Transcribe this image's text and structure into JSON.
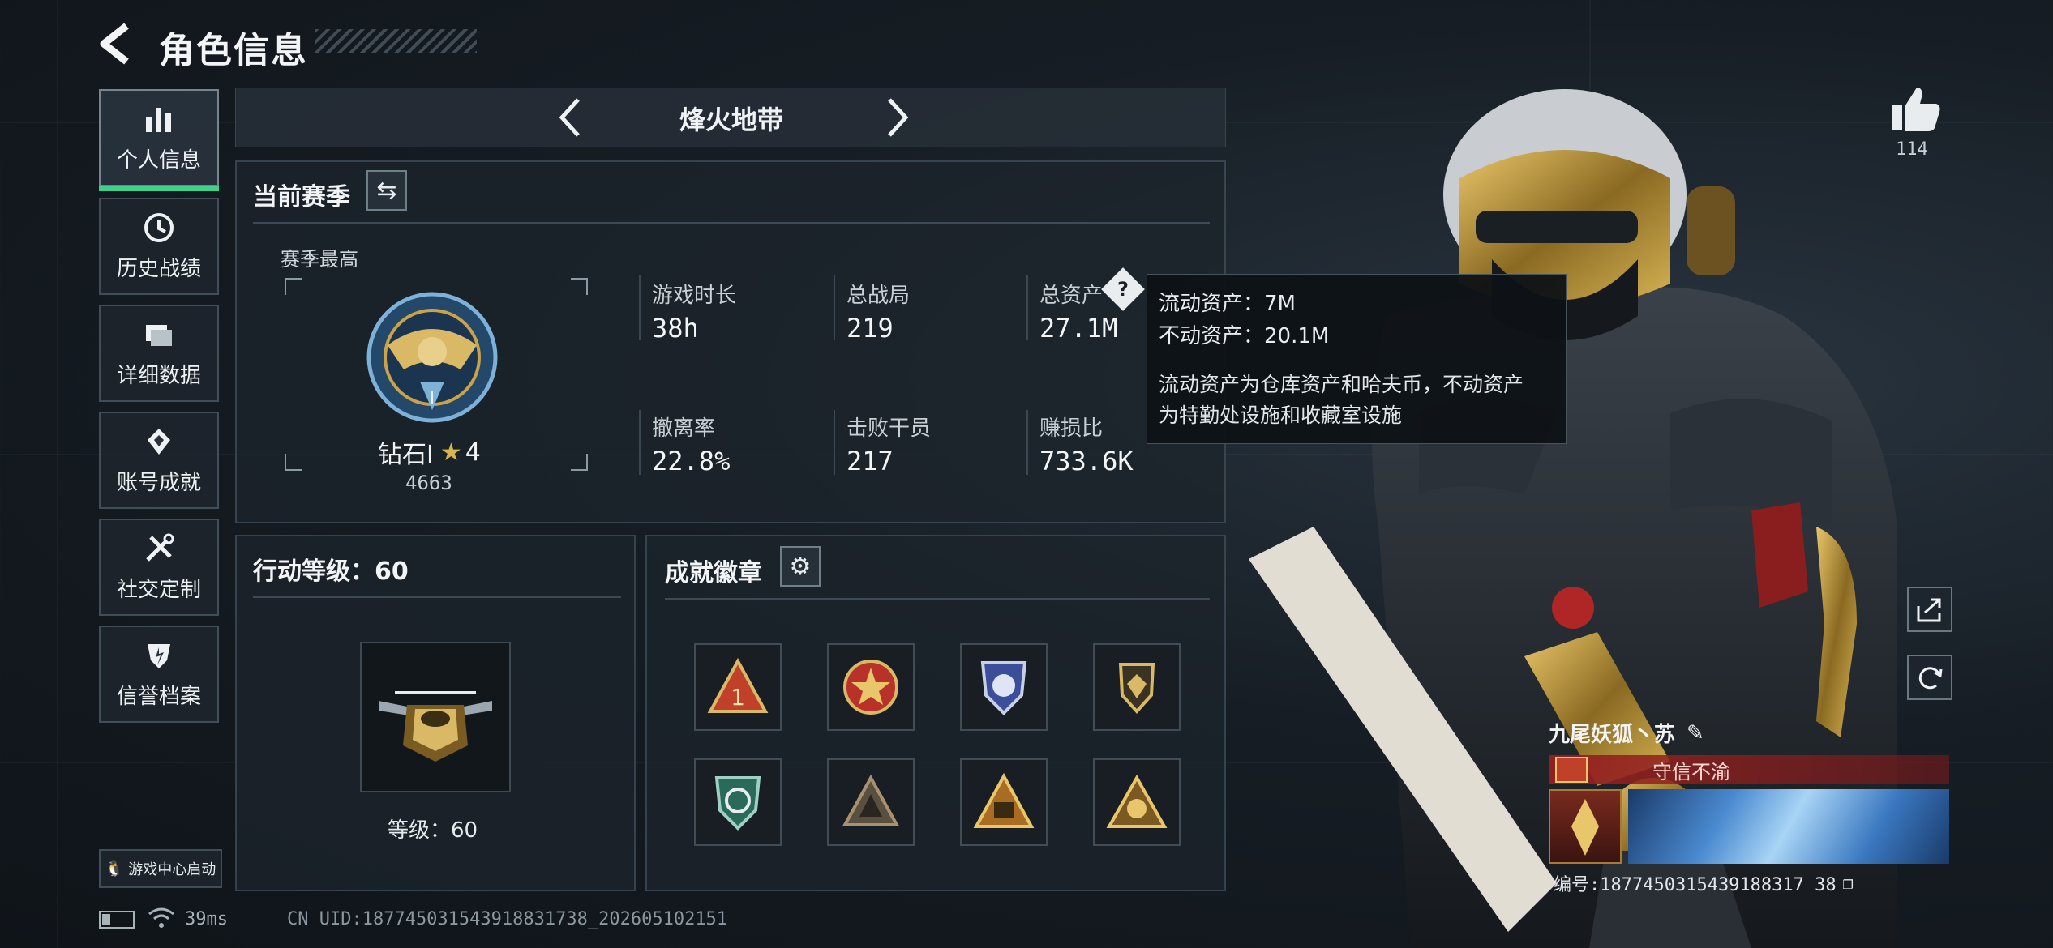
{
  "header": {
    "title": "角色信息"
  },
  "sidebar": {
    "items": [
      {
        "label": "个人信息",
        "active": true
      },
      {
        "label": "历史战绩"
      },
      {
        "label": "详细数据"
      },
      {
        "label": "账号成就"
      },
      {
        "label": "社交定制"
      },
      {
        "label": "信誉档案"
      }
    ],
    "launch_label": "游戏中心启动"
  },
  "map": {
    "name": "烽火地带"
  },
  "season": {
    "title": "当前赛季",
    "best_label": "赛季最高",
    "rank_name": "钻石Ⅰ",
    "rank_stars": "4",
    "rank_score": "4663",
    "stats": [
      {
        "label": "游戏时长",
        "value": "38h"
      },
      {
        "label": "总战局",
        "value": "219"
      },
      {
        "label": "总资产",
        "value": "27.1M"
      },
      {
        "label": "撤离率",
        "value": "22.8%"
      },
      {
        "label": "击败干员",
        "value": "217"
      },
      {
        "label": "赚损比",
        "value": "733.6K"
      }
    ]
  },
  "tooltip": {
    "liquid": "流动资产：7M",
    "fixed": "不动资产：20.1M",
    "desc_line1": "流动资产为仓库资产和哈夫币，不动资产",
    "desc_line2": "为特勤处设施和收藏室设施"
  },
  "action_level": {
    "title": "行动等级：60",
    "level_text": "等级：60"
  },
  "achievements": {
    "title": "成就徽章"
  },
  "likes": {
    "count": "114"
  },
  "player": {
    "name": "九尾妖狐丶苏",
    "tag": "守信不渝",
    "id_text": "编号:1877450315439188317 38"
  },
  "status": {
    "ping": "39ms",
    "uid": "CN UID:18774503154391883​1738_202605102151"
  },
  "colors": {
    "accent_green": "#3fd18c",
    "tag_red": "#8a1e1e",
    "gold": "#c9a24a"
  }
}
